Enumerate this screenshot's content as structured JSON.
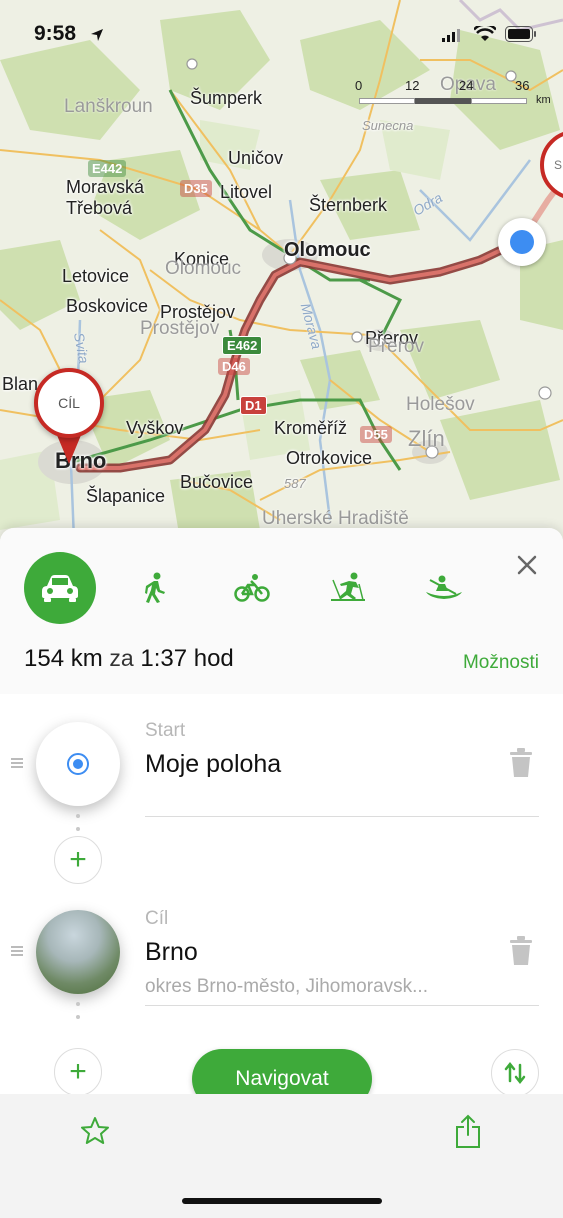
{
  "status_bar": {
    "time": "9:58"
  },
  "map": {
    "scale": {
      "ticks": [
        "0",
        "12",
        "24",
        "36"
      ],
      "unit": "km"
    },
    "places": {
      "lanskroun": "Lanškroun",
      "sumperk": "Šumperk",
      "opava": "Opava",
      "unicov": "Uničov",
      "moravska": "Moravská",
      "trebova": "Třebová",
      "litovel": "Litovel",
      "sternberk": "Šternberk",
      "konice": "Konice",
      "olomouc": "Olomouc",
      "olomouc_faded": "Olomouc",
      "letovice": "Letovice",
      "boskovice": "Boskovice",
      "prostejov": "Prostějov",
      "prostejov_faded": "Prostějov",
      "prerov": "Přerov",
      "prerov_faded": "Přerov",
      "blansko": "Blan",
      "vyskov": "Vyškov",
      "kromeriz": "Kroměříž",
      "holesov": "Holešov",
      "zlin": "Zlín",
      "otrokovice": "Otrokovice",
      "brno": "Brno",
      "slapanice": "Šlapanice",
      "bucovice": "Bučovice",
      "uherske": "Uherské Hradiště",
      "morava": "Morava",
      "svitava": "Svita",
      "odra": "Odra",
      "sunecna": "Sunecna",
      "altitude": "587"
    },
    "shields": {
      "d35": "D35",
      "e462": "E462",
      "d46": "D46",
      "d1": "D1",
      "d55": "D55",
      "e442": "E442"
    },
    "pin_destination_label": "CÍL",
    "pin_start_label": "S"
  },
  "route": {
    "modes": [
      "car",
      "walk",
      "bike",
      "ski",
      "boat"
    ],
    "active_mode": "car",
    "distance": "154 km",
    "za": "za",
    "duration": "1:37 hod",
    "options_label": "Možnosti"
  },
  "waypoints": [
    {
      "label": "Start",
      "title": "Moje poloha",
      "subtitle": ""
    },
    {
      "label": "Cíl",
      "title": "Brno",
      "subtitle": "okres Brno-město, Jihomoravsk..."
    }
  ],
  "navigate_label": "Navigovat",
  "colors": {
    "accent": "#3eaa3a",
    "route": "#c62a24",
    "location": "#3d8df2"
  }
}
